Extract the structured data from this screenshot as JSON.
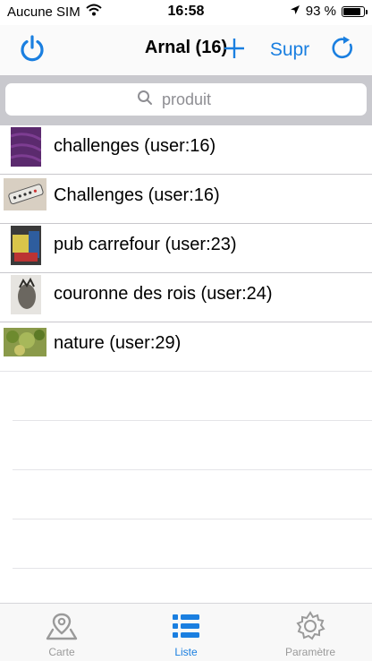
{
  "status_bar": {
    "carrier": "Aucune SIM",
    "time": "16:58",
    "battery_text": "93 %",
    "battery_level": 0.93,
    "icons": [
      "wifi-icon",
      "location-arrow-icon",
      "battery-icon"
    ]
  },
  "nav": {
    "title": "Arnal (16)",
    "supr_label": "Supr",
    "accent_color": "#1a7fe0",
    "icons": [
      "power-icon",
      "plus-icon",
      "refresh-icon"
    ]
  },
  "search": {
    "placeholder": "produit",
    "value": ""
  },
  "list": {
    "items": [
      {
        "label": "challenges  (user:16)",
        "thumb": "purple-fabric"
      },
      {
        "label": "Challenges  (user:16)",
        "thumb": "remote-control"
      },
      {
        "label": "pub carrefour  (user:23)",
        "thumb": "carrefour-poster"
      },
      {
        "label": "couronne des rois (user:24)",
        "thumb": "crown-photo"
      },
      {
        "label": "nature (user:29)",
        "thumb": "tree-leaves"
      }
    ]
  },
  "tabs": [
    {
      "label": "Carte",
      "icon": "map-pin-icon",
      "active": false
    },
    {
      "label": "Liste",
      "icon": "list-icon",
      "active": true
    },
    {
      "label": "Paramètre",
      "icon": "gear-icon",
      "active": false
    }
  ]
}
